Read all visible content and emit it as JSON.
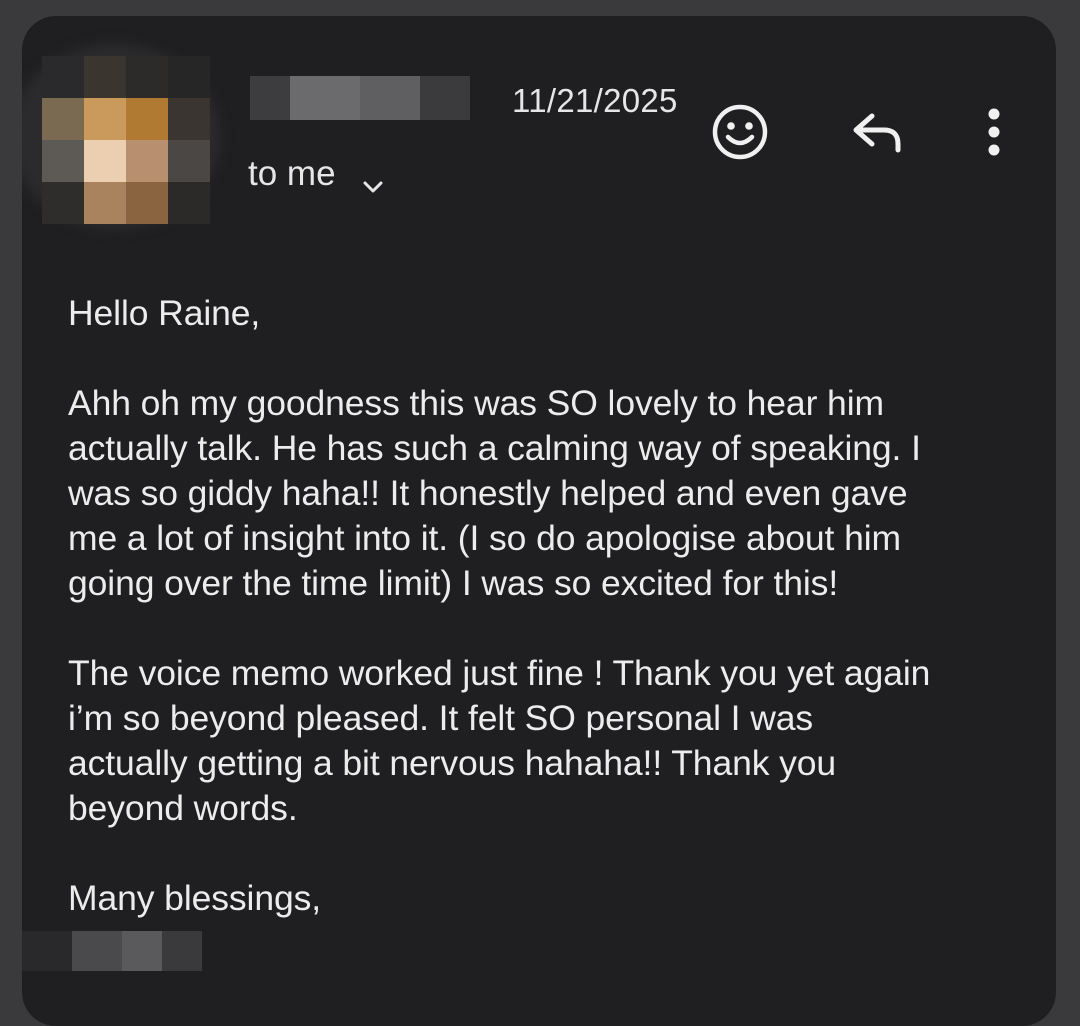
{
  "header": {
    "date": "11/21/2025",
    "recipient_label": "to me",
    "icons": {
      "expand": "chevron-down-icon",
      "emoji": "smiley-icon",
      "reply": "reply-icon",
      "more": "more-vert-icon"
    }
  },
  "message": {
    "greeting": "Hello Raine,",
    "paragraphs": [
      "Ahh oh my goodness this was SO lovely to hear him\nactually talk. He has such a calming way of speaking. I\nwas so giddy haha!! It honestly helped and even gave\nme a lot of insight into it. (I so do apologise about him\ngoing over the time limit) I was so excited for this!",
      "The voice memo worked just fine ! Thank you yet again\ni’m so beyond pleased. It felt SO personal I was\nactually getting a bit nervous hahaha!! Thank you\nbeyond words."
    ],
    "closing": "Many blessings,"
  },
  "colors": {
    "background": "#1f1f21",
    "text": "#ececec",
    "page_backdrop": "#3a3a3c"
  }
}
